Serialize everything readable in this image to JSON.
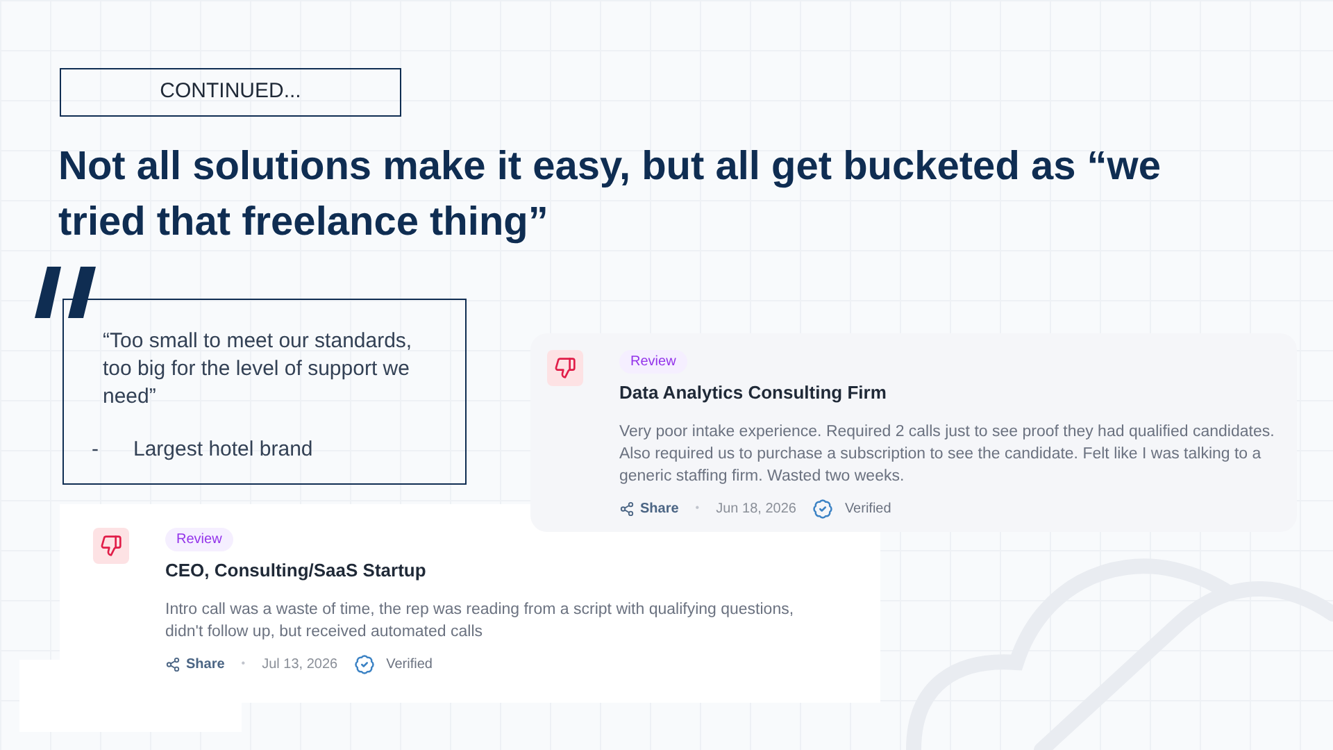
{
  "label": "CONTINUED...",
  "title": "Not all solutions make it easy, but all get bucketed as “we tried that freelance thing”",
  "quote": {
    "text": "“Too small to meet our standards, too big for the level of support we need”",
    "dash": "-",
    "source": "Largest hotel brand"
  },
  "reviews": [
    {
      "badge": "Review",
      "title": "Data Analytics Consulting Firm",
      "body": "Very poor intake experience. Required 2 calls just to see proof they had qualified candidates. Also required us to purchase a subscription to see the candidate. Felt like I was talking to a generic staffing firm. Wasted two weeks.",
      "share": "Share",
      "separator": "•",
      "date": "Jun 18, 2026",
      "verified": "Verified"
    },
    {
      "badge": "Review",
      "title": "CEO, Consulting/SaaS Startup",
      "body": "Intro call was a waste of time, the rep was reading from a script with qualifying questions, didn't follow up, but received automated calls",
      "share": "Share",
      "separator": "•",
      "date": "Jul 13, 2026",
      "verified": "Verified"
    }
  ]
}
